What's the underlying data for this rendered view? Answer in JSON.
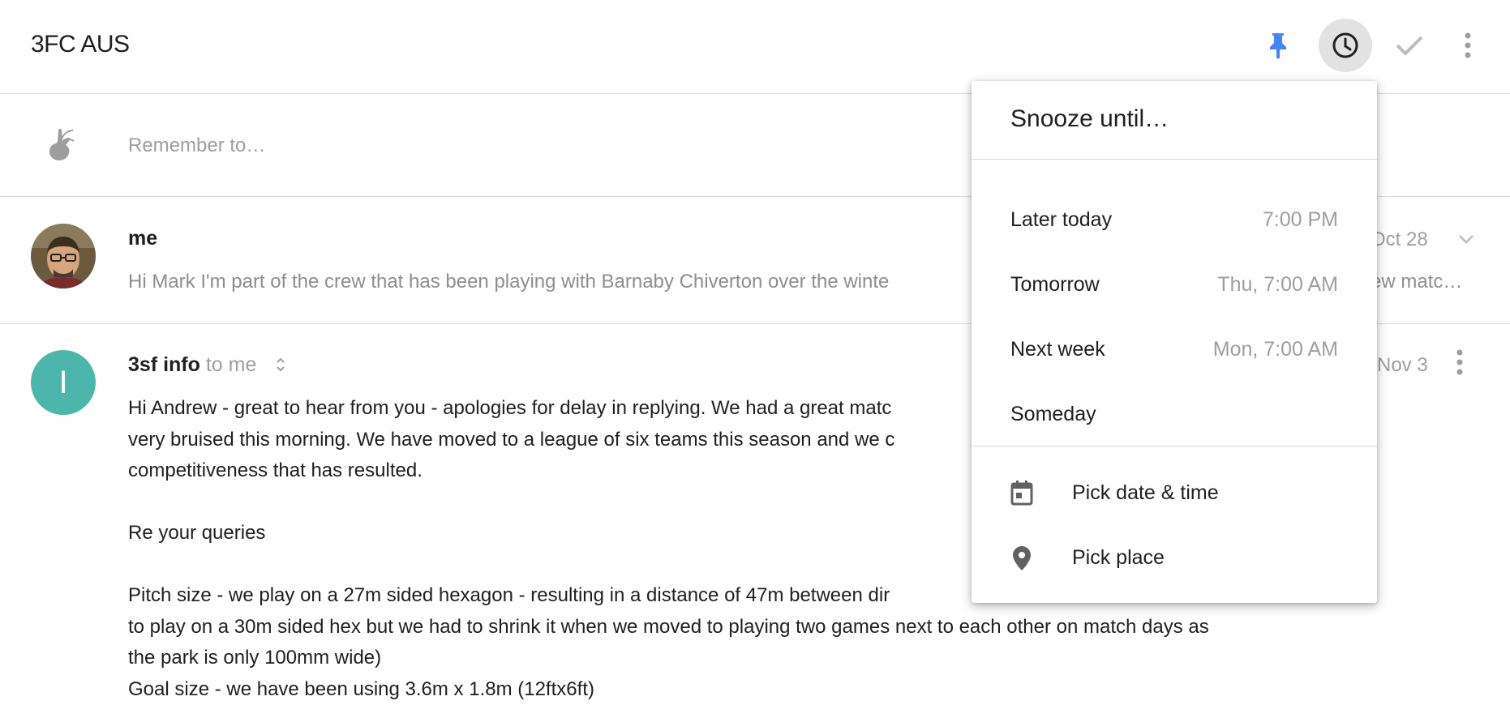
{
  "header": {
    "title": "3FC AUS",
    "icons": {
      "pin": "pin-icon",
      "snooze": "clock-icon",
      "done": "check-icon",
      "more": "more-vert-icon"
    },
    "colors": {
      "pin": "#4285f4",
      "snooze_bg": "#e2e2e2",
      "done": "#bdbdbd",
      "more": "#9e9e9e"
    }
  },
  "reminder": {
    "placeholder": "Remember to…",
    "icon": "reminder-finger-icon"
  },
  "messages": [
    {
      "sender": "me",
      "date": "Oct 28",
      "snippet": "Hi Mark I'm part of the crew that has been playing with Barnaby Chiverton over the winte",
      "snippet_tail": "ew matc…",
      "avatar": "user-photo"
    },
    {
      "sender": "3sf info",
      "recipients": "to me",
      "date": "Nov 3",
      "avatar_letter": "I",
      "avatar_color": "#4db6ac",
      "body_lines": [
        "Hi Andrew - great to hear from you - apologies for delay in replying. We had a great matc",
        "very bruised this morning. We have moved to a league of six teams this season and we c",
        "competitiveness that has resulted.",
        "",
        "Re your queries",
        "",
        "Pitch size - we play on a 27m sided hexagon - resulting in a distance of 47m between dir",
        "to play on a 30m sided hex but we had to shrink it when we moved to playing two games next to each other on match days as",
        "the park is only 100mm wide)",
        "Goal size - we have been using 3.6m x 1.8m (12ftx6ft)"
      ]
    }
  ],
  "snooze_menu": {
    "title": "Snooze until…",
    "options": [
      {
        "label": "Later today",
        "time": "7:00 PM"
      },
      {
        "label": "Tomorrow",
        "time": "Thu, 7:00 AM"
      },
      {
        "label": "Next week",
        "time": "Mon, 7:00 AM"
      },
      {
        "label": "Someday",
        "time": ""
      }
    ],
    "actions": [
      {
        "label": "Pick date & time",
        "icon": "calendar-icon"
      },
      {
        "label": "Pick place",
        "icon": "location-pin-icon"
      }
    ]
  }
}
